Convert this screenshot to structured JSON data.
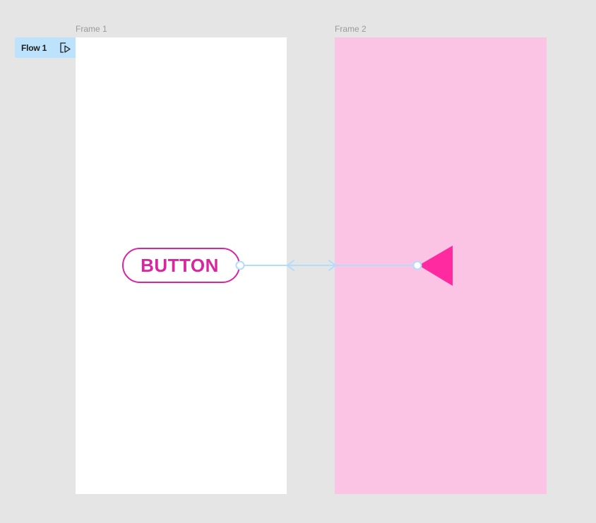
{
  "canvas": {
    "background": "#e5e5e5"
  },
  "frames": [
    {
      "name": "Frame 1",
      "fill": "#ffffff"
    },
    {
      "name": "Frame 2",
      "fill": "#fcc4e4"
    }
  ],
  "flow": {
    "label": "Flow 1",
    "icon": "play-flow-icon",
    "color": "#bde3fc"
  },
  "frame1": {
    "button": {
      "label": "BUTTON",
      "color": "#d9259f"
    }
  },
  "frame2": {
    "shape": {
      "kind": "triangle-left",
      "color": "#ff2aa0"
    }
  },
  "prototype_connection": {
    "color": "#b3dcfb",
    "from": "BUTTON",
    "to": "Frame 2"
  }
}
